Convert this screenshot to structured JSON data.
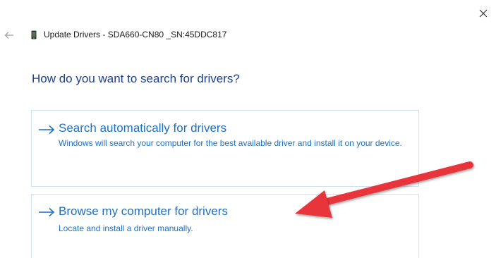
{
  "window": {
    "title": "Update Drivers - SDA660-CN80 _SN:45DDC817"
  },
  "icons": {
    "close": "close-icon",
    "back": "back-arrow-icon",
    "device": "device-icon",
    "option_arrow": "right-arrow-icon",
    "annotation": "red-pointer-arrow"
  },
  "main": {
    "heading": "How do you want to search for drivers?",
    "options": [
      {
        "title": "Search automatically for drivers",
        "description": "Windows will search your computer for the best available driver and install it on your device."
      },
      {
        "title": "Browse my computer for drivers",
        "description": "Locate and install a driver manually."
      }
    ]
  },
  "colors": {
    "heading": "#1f3e8a",
    "link": "#1f6fc2",
    "option_border": "#cfe2f3",
    "annotation_arrow": "#e8343a"
  }
}
